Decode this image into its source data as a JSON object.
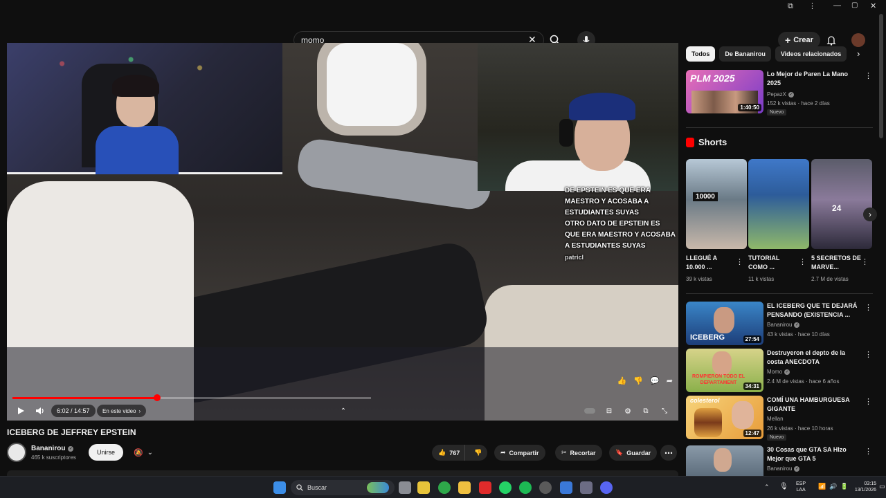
{
  "search": {
    "value": "momo"
  },
  "masthead": {
    "create_label": "Crear"
  },
  "player": {
    "time": "6:02 / 14:57",
    "chapter": "En este video",
    "progress": 0.403,
    "chat": [
      "DE EPSTEIN ES QUE ERA",
      "MAESTRO Y ACOSABA A",
      "ESTUDIANTES SUYAS",
      "OTRO DATO DE EPSTEIN ES",
      "QUE ERA MAESTRO Y ACOSABA",
      "A ESTUDIANTES SUYAS"
    ],
    "chat_user": "patricl"
  },
  "video": {
    "title": "ICEBERG DE JEFFREY EPSTEIN",
    "channel": "Bananirou",
    "subscribers": "465 k suscriptores",
    "subscribe_label": "Unirse",
    "likes": "767",
    "share_label": "Compartir",
    "clip_label": "Recortar",
    "save_label": "Guardar"
  },
  "sidebar": {
    "chips": [
      "Todos",
      "De Bananirou",
      "Videos relacionados"
    ],
    "top_video": {
      "title": "Lo Mejor de Paren La Mano 2025",
      "channel": "PepazX",
      "meta": "152 k vistas · hace 2 días",
      "badge": "Nuevo",
      "duration": "1:40:50",
      "thumb_text": "PLM 2025"
    },
    "shorts_label": "Shorts",
    "shorts": [
      {
        "title": "LLEGUÉ A 10.000 ...",
        "views": "39 k vistas",
        "overlay": "10000"
      },
      {
        "title": "TUTORIAL COMO ...",
        "views": "11 k vistas",
        "overlay": ""
      },
      {
        "title": "5 SECRETOS DE MARVE...",
        "views": "2.7 M de vistas",
        "overlay": "24"
      }
    ],
    "videos": [
      {
        "title": "EL ICEBERG QUE TE DEJARÁ PENSANDO (EXISTENCIA ...",
        "channel": "Bananirou",
        "meta": "43 k vistas · hace 10 días",
        "duration": "27:54",
        "badge": "",
        "thumb_text": "ICEBERG"
      },
      {
        "title": "Destruyeron el depto de la costa ANECDOTA",
        "channel": "Momo",
        "meta": "2.4 M de vistas · hace 6 años",
        "duration": "34:31",
        "badge": "",
        "thumb_text": "ROMPIERON TODO EL DEPARTAMENT"
      },
      {
        "title": "COMÍ UNA HAMBURGUESA GIGANTE",
        "channel": "Mellan",
        "meta": "26 k vistas · hace 10 horas",
        "duration": "12:47",
        "badge": "Nuevo",
        "thumb_text": "colesterol"
      },
      {
        "title": "30 Cosas que GTA SA HIzo Mejor que GTA 5",
        "channel": "Bananirou",
        "meta": "",
        "duration": "",
        "badge": "",
        "thumb_text": ""
      }
    ]
  },
  "taskbar": {
    "search_label": "Buscar",
    "lang": "ESP",
    "lang2": "LAA",
    "time": "03:15",
    "date": "13/1/2026"
  }
}
